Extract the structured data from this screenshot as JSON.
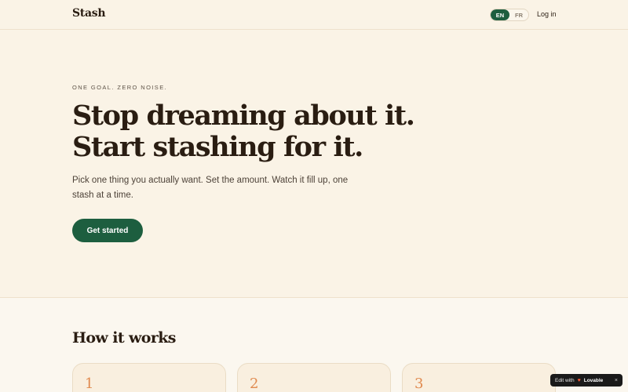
{
  "header": {
    "logo": "Stash",
    "languages": [
      {
        "code": "EN",
        "active": true
      },
      {
        "code": "FR",
        "active": false
      }
    ],
    "login_label": "Log in"
  },
  "hero": {
    "eyebrow": "ONE GOAL. ZERO NOISE.",
    "headline": "Stop dreaming about it. Start stashing for it.",
    "subtitle": "Pick one thing you actually want. Set the amount. Watch it fill up, one stash at a time.",
    "cta_label": "Get started"
  },
  "how_it_works": {
    "title": "How it works",
    "steps": [
      {
        "number": "1"
      },
      {
        "number": "2"
      },
      {
        "number": "3"
      }
    ]
  },
  "badge": {
    "prefix": "Edit with",
    "heart_icon": "heart-icon",
    "brand": "Lovable",
    "close": "×"
  },
  "colors": {
    "background": "#faf3e6",
    "accent_green": "#1d5e3f",
    "step_number": "#e08a4f",
    "text": "#2a1d12"
  }
}
